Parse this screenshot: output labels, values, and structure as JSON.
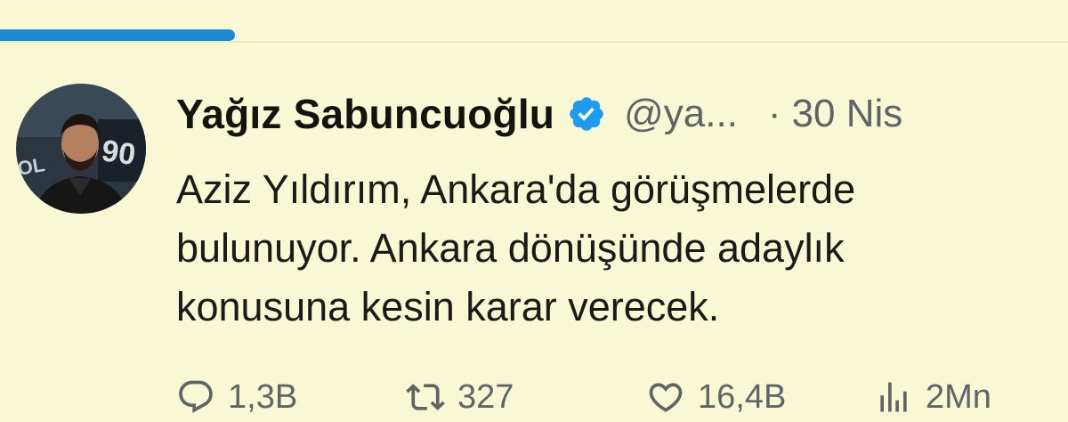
{
  "progress": {
    "fraction": 0.22,
    "color": "#1d8bd4"
  },
  "tweet": {
    "author": {
      "display_name": "Yağız Sabuncuoğlu",
      "handle": "@ya...",
      "verified": true,
      "avatar_icon": "profile-photo"
    },
    "separator": "·",
    "date": "30 Nis",
    "text_lines": [
      "Aziz Yıldırım, Ankara'da görüşmelerde",
      "bulunuyor. Ankara dönüşünde adaylık",
      "konusuna kesin karar verecek."
    ],
    "actions": {
      "replies": "1,3B",
      "reposts": "327",
      "likes": "16,4B",
      "views": "2Mn"
    }
  },
  "colors": {
    "background": "#f8f8d4",
    "verified_badge": "#1d9bf0",
    "secondary_text": "#5f6467"
  }
}
